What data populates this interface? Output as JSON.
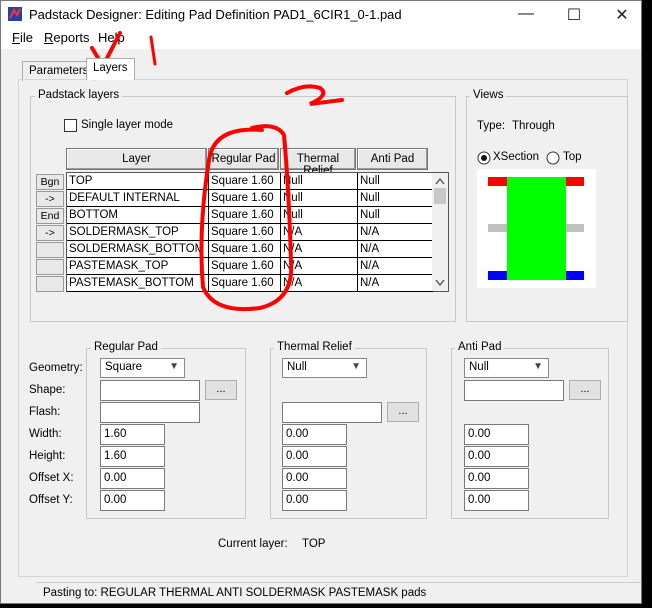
{
  "window": {
    "title": "Padstack Designer: Editing Pad Definition PAD1_6CIR1_0-1.pad",
    "controls": {
      "minimize": "—",
      "maximize": "☐",
      "close": "✕"
    }
  },
  "menu": {
    "file": {
      "mnemonic": "F",
      "rest": "ile"
    },
    "reports": {
      "mnemonic": "R",
      "rest": "eports"
    },
    "help": {
      "mnemonic": "",
      "rest": "Help"
    }
  },
  "tabs": [
    {
      "label": "Parameters"
    },
    {
      "label": "Layers"
    }
  ],
  "padstack_layers": {
    "group_label": "Padstack layers",
    "single_layer_mode_label": "Single layer mode",
    "headers": [
      "Layer",
      "Regular Pad",
      "Thermal Relief",
      "Anti Pad"
    ],
    "side_buttons": [
      "Bgn",
      "->",
      "End",
      "->",
      "",
      "",
      ""
    ],
    "rows": [
      [
        "TOP",
        "Square 1.60",
        "Null",
        "Null"
      ],
      [
        "DEFAULT INTERNAL",
        "Square 1.60",
        "Null",
        "Null"
      ],
      [
        "BOTTOM",
        "Square 1.60",
        "Null",
        "Null"
      ],
      [
        "SOLDERMASK_TOP",
        "Square 1.60",
        "N/A",
        "N/A"
      ],
      [
        "SOLDERMASK_BOTTOM",
        "Square 1.60",
        "N/A",
        "N/A"
      ],
      [
        "PASTEMASK_TOP",
        "Square 1.60",
        "N/A",
        "N/A"
      ],
      [
        "PASTEMASK_BOTTOM",
        "Square 1.60",
        "N/A",
        "N/A"
      ]
    ]
  },
  "views": {
    "group_label": "Views",
    "type_label": "Type:",
    "type_value": "Through",
    "xsection_label": "XSection",
    "top_label": "Top",
    "selected": "XSection",
    "colors": {
      "top_pad": "#ff0000",
      "body": "#00ff00",
      "internal": "#c0c0c0",
      "bottom_pad": "#0000ff"
    }
  },
  "pad_editor": {
    "labels": {
      "geometry": "Geometry:",
      "shape": "Shape:",
      "flash": "Flash:",
      "width": "Width:",
      "height": "Height:",
      "offset_x": "Offset X:",
      "offset_y": "Offset Y:"
    },
    "regular": {
      "label": "Regular Pad",
      "geometry": "Square",
      "shape": "",
      "flash": "",
      "width": "1.60",
      "height": "1.60",
      "offset_x": "0.00",
      "offset_y": "0.00"
    },
    "thermal": {
      "label": "Thermal Relief",
      "geometry": "Null",
      "flash": "",
      "width": "0.00",
      "height": "0.00",
      "offset_x": "0.00",
      "offset_y": "0.00"
    },
    "anti": {
      "label": "Anti Pad",
      "geometry": "Null",
      "shape": "",
      "width": "0.00",
      "height": "0.00",
      "offset_x": "0.00",
      "offset_y": "0.00"
    },
    "ellipsis": "...",
    "current_layer_label": "Current layer:",
    "current_layer_value": "TOP"
  },
  "status": {
    "text": "Pasting to: REGULAR  THERMAL  ANTI  SOLDERMASK  PASTEMASK  pads"
  },
  "annotations": {
    "color": "#ff0000",
    "mark_1": "1",
    "mark_2": "2"
  }
}
